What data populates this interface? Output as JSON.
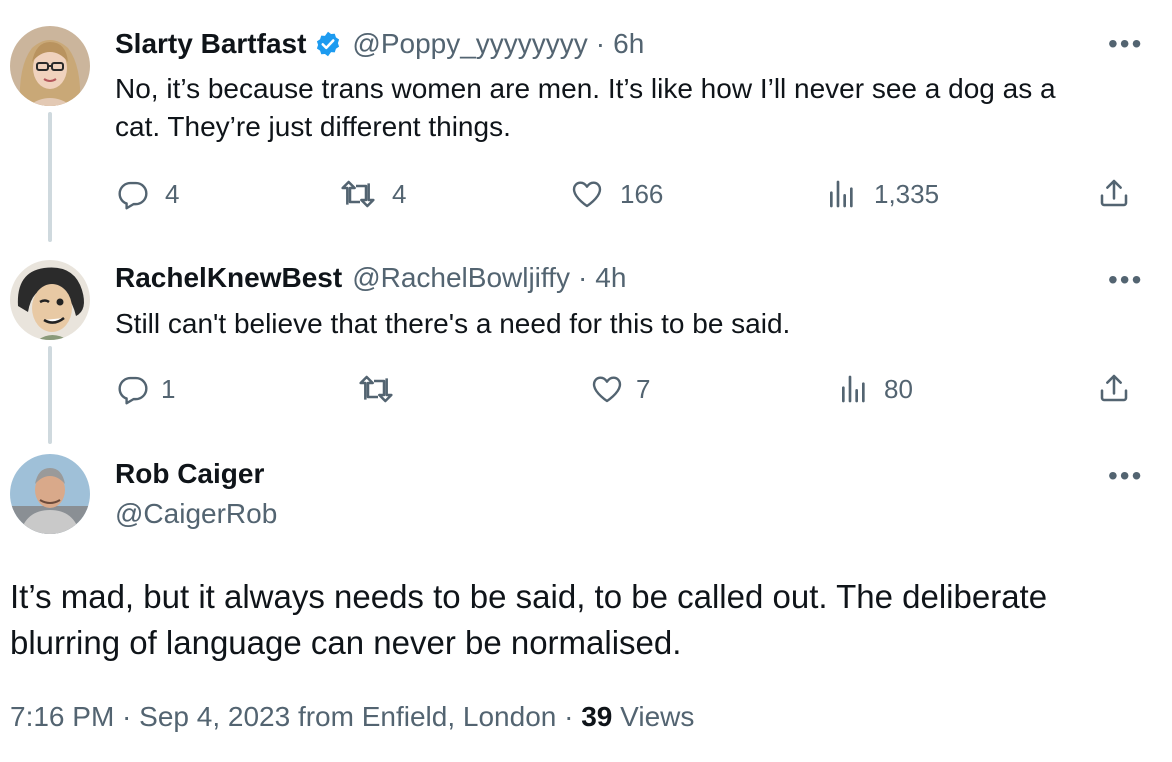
{
  "tweets": [
    {
      "display_name": "Slarty Bartfast",
      "verified": true,
      "handle": "@Poppy_yyyyyyyy",
      "time_sep": "·",
      "time": "6h",
      "text_line1": "No, it’s because trans women are men. It’s like how I’ll never see a dog as a",
      "text_line2": "cat. They’re just different things.",
      "replies": "4",
      "retweets": "4",
      "likes": "166",
      "views": "1,335"
    },
    {
      "display_name": "RachelKnewBest",
      "handle": "@RachelBowljiffy",
      "time_sep": "·",
      "time": "4h",
      "text": "Still can't believe that there's a need for this to be said.",
      "replies": "1",
      "retweets": "",
      "likes": "7",
      "views": "80"
    }
  ],
  "main_tweet": {
    "display_name": "Rob Caiger",
    "handle": "@CaigerRob",
    "text_line1": "It’s mad, but it always needs to be said, to be called out. The deliberate",
    "text_line2": "blurring of language can never be normalised.",
    "timestamp": "7:16 PM · Sep 4, 2023 from Enfield, London",
    "meta_sep": "·",
    "views_count": "39",
    "views_label": "Views"
  },
  "icons": {
    "more": "more-dots-icon",
    "reply": "reply-icon",
    "retweet": "retweet-icon",
    "like": "heart-icon",
    "views": "views-bar-chart-icon",
    "share": "share-icon",
    "verified": "verified-badge-icon"
  },
  "colors": {
    "accent": "#1d9bf0",
    "muted": "#536471",
    "text": "#0f1419",
    "thread_line": "#cfd9de"
  }
}
